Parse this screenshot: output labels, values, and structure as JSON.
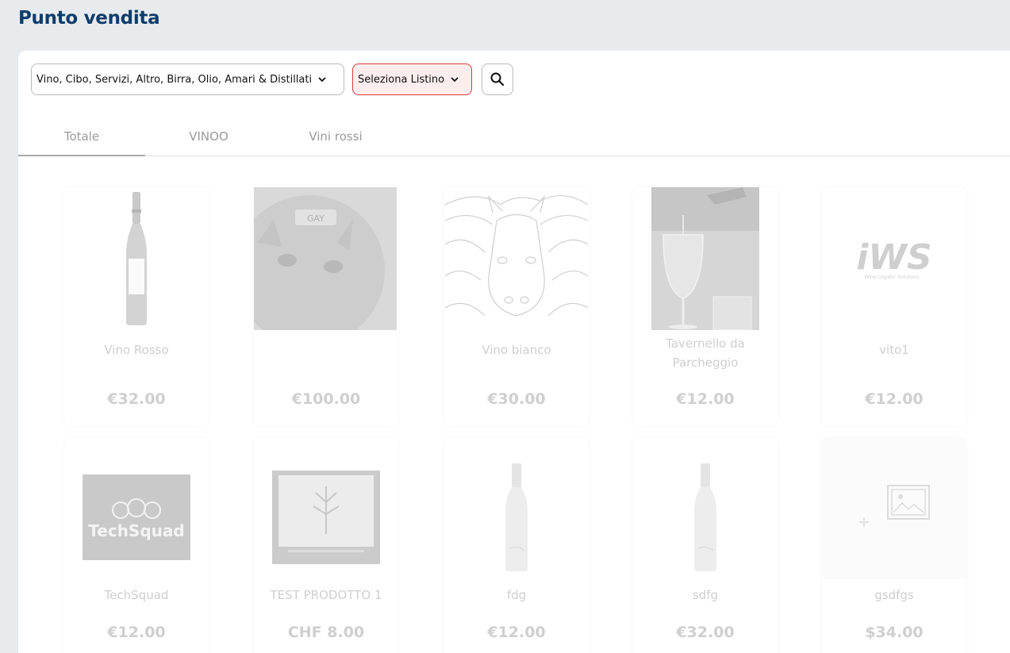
{
  "page": {
    "title": "Punto vendita"
  },
  "filters": {
    "categories": "Vino, Cibo, Servizi, Altro, Birra, Olio, Amari & Distillati",
    "price_list": "Seleziona Listino"
  },
  "tabs": [
    {
      "label": "Totale",
      "active": true
    },
    {
      "label": "VINOO",
      "active": false
    },
    {
      "label": "Vini rossi",
      "active": false
    }
  ],
  "products": [
    {
      "name": "Vino Rosso",
      "price": "€32.00",
      "image": "wine-bottle-red"
    },
    {
      "name": "",
      "price": "€100.00",
      "image": "cat-photo",
      "image_text": "GAY"
    },
    {
      "name": "Vino bianco",
      "price": "€30.00",
      "image": "horse-sketch"
    },
    {
      "name": "Tavernello da Parcheggio",
      "price": "€12.00",
      "image": "wine-pour-photo"
    },
    {
      "name": "vito1",
      "price": "€12.00",
      "image": "iws-logo",
      "image_text": "iWS",
      "image_subtext": "Wine Logistic Solutions"
    },
    {
      "name": "TechSquad",
      "price": "€12.00",
      "image": "techsquad-logo",
      "image_text": "TechSquad"
    },
    {
      "name": "TEST PRODOTTO 1",
      "price": "CHF 8.00",
      "image": "book-cover"
    },
    {
      "name": "fdg",
      "price": "€12.00",
      "image": "wine-bottle-white"
    },
    {
      "name": "sdfg",
      "price": "€32.00",
      "image": "wine-bottle-white"
    },
    {
      "name": "gsdfgs",
      "price": "$34.00",
      "image": "image-placeholder"
    }
  ]
}
